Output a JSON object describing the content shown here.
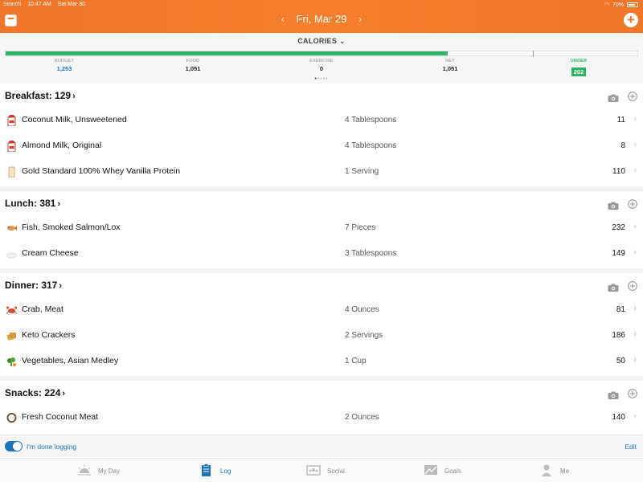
{
  "status": {
    "left": [
      "Search",
      "10:47 AM",
      "Sat Mar 30"
    ],
    "battery": "70%"
  },
  "header": {
    "date": "Fri, Mar 29",
    "prev": "‹",
    "next": "›",
    "add": "+"
  },
  "summary": {
    "title": "CALORIES",
    "progress_fraction": 0.7,
    "stats": [
      {
        "label": "BUDGET",
        "value": "1,253"
      },
      {
        "label": "FOOD",
        "value": "1,051"
      },
      {
        "label": "EXERCISE",
        "value": "0"
      },
      {
        "label": "NET",
        "value": "1,051"
      },
      {
        "label": "UNDER",
        "value": "202"
      }
    ]
  },
  "meals": [
    {
      "title": "Breakfast: 129",
      "items": [
        {
          "name": "Coconut Milk, Unsweetened",
          "qty": "4 Tablespoons",
          "cal": "11",
          "icon": "carton-icon"
        },
        {
          "name": "Almond Milk, Original",
          "qty": "4 Tablespoons",
          "cal": "8",
          "icon": "carton-icon"
        },
        {
          "name": "Gold Standard 100% Whey Vanilla Protein",
          "qty": "1 Serving",
          "cal": "110",
          "icon": "glass-icon"
        }
      ]
    },
    {
      "title": "Lunch: 381",
      "items": [
        {
          "name": "Fish, Smoked Salmon/Lox",
          "qty": "7 Pieces",
          "cal": "232",
          "icon": "fish-icon"
        },
        {
          "name": "Cream Cheese",
          "qty": "3 Tablespoons",
          "cal": "149",
          "icon": "cheese-icon"
        }
      ]
    },
    {
      "title": "Dinner: 317",
      "items": [
        {
          "name": "Crab, Meat",
          "qty": "4 Ounces",
          "cal": "81",
          "icon": "crab-icon"
        },
        {
          "name": "Keto Crackers",
          "qty": "2 Servings",
          "cal": "186",
          "icon": "crackers-icon"
        },
        {
          "name": "Vegetables, Asian Medley",
          "qty": "1 Cup",
          "cal": "50",
          "icon": "vegetables-icon"
        }
      ]
    },
    {
      "title": "Snacks: 224",
      "items": [
        {
          "name": "Fresh Coconut Meat",
          "qty": "2 Ounces",
          "cal": "140",
          "icon": "coconut-icon"
        }
      ]
    }
  ],
  "footer": {
    "done_label": "I'm done logging",
    "edit_label": "Edit"
  },
  "tabs": [
    {
      "label": "My Day",
      "icon": "sun-icon"
    },
    {
      "label": "Log",
      "icon": "clipboard-icon",
      "active": true
    },
    {
      "label": "Social",
      "icon": "social-icon"
    },
    {
      "label": "Goals",
      "icon": "goals-icon"
    },
    {
      "label": "Me",
      "icon": "person-icon"
    }
  ],
  "colors": {
    "accent": "#f0762a",
    "green": "#2db568",
    "blue": "#1e73b8"
  }
}
